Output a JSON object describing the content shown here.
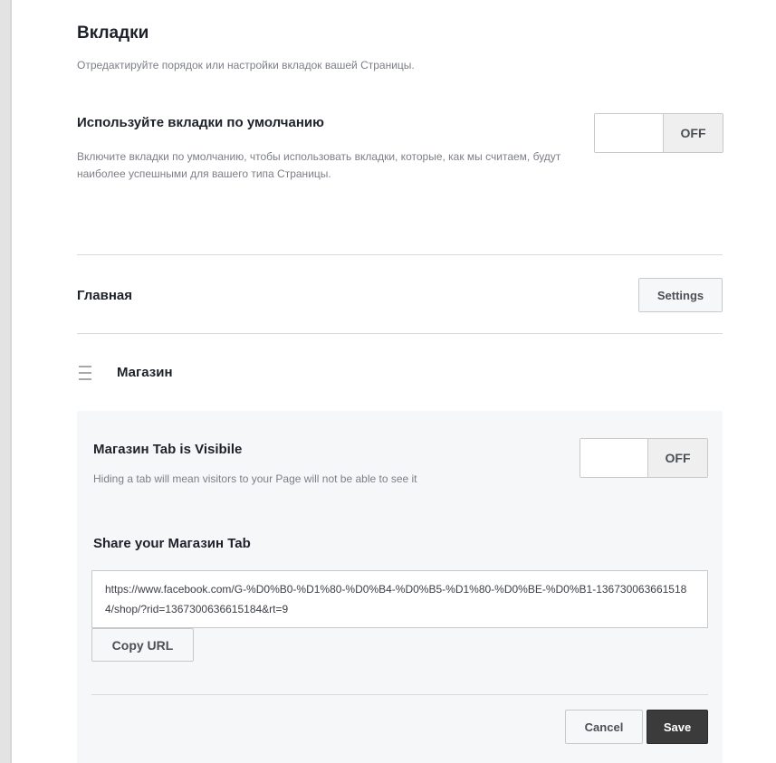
{
  "tabs_section": {
    "title": "Вкладки",
    "description": "Отредактируйте порядок или настройки вкладок вашей Страницы."
  },
  "default_tabs": {
    "title": "Используйте вкладки по умолчанию",
    "description": "Включите вкладки по умолчанию, чтобы использовать вкладки, которые, как мы считаем, будут наиболее успешными для вашего типа Страницы.",
    "toggle_state": "OFF"
  },
  "home_tab": {
    "label": "Главная",
    "settings_label": "Settings"
  },
  "shop_tab": {
    "label": "Магазин",
    "visible_title": "Магазин Tab is Visibile",
    "visible_description": "Hiding a tab will mean visitors to your Page will not be able to see it",
    "visible_toggle_state": "OFF",
    "share_title": "Share your Магазин Tab",
    "share_url": "https://www.facebook.com/G-%D0%B0-%D1%80-%D0%B4-%D0%B5-%D1%80-%D0%BE-%D0%B1-1367300636615184/shop/?rid=1367300636615184&rt=9",
    "copy_url_label": "Copy URL",
    "cancel_label": "Cancel",
    "save_label": "Save"
  },
  "icons": {
    "drag_handle": "hamburger-drag-icon"
  },
  "colors": {
    "primary_button": "#3b3b3b",
    "panel_background": "#f6f7f9",
    "muted_text": "#7b7f86"
  }
}
